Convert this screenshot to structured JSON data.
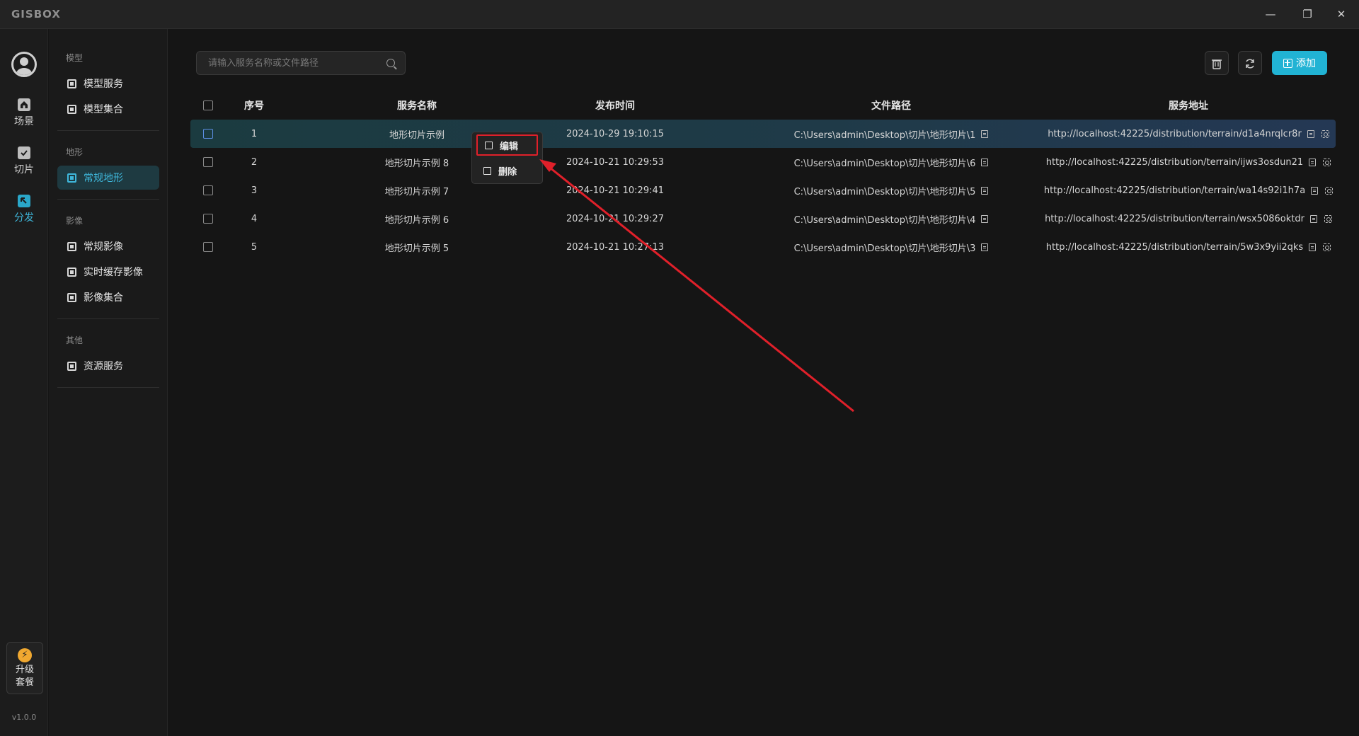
{
  "app": {
    "logo": "GISBOX",
    "window_controls": {
      "minimize": "—",
      "maximize": "❐",
      "close": "✕"
    }
  },
  "rail": {
    "items": [
      {
        "label": "场景",
        "icon": "home-icon",
        "active": false
      },
      {
        "label": "切片",
        "icon": "slice-icon",
        "active": false
      },
      {
        "label": "分发",
        "icon": "distribute-icon",
        "active": true
      }
    ],
    "upgrade": {
      "icon": "⚡",
      "label": "升级套餐"
    },
    "version": "v1.0.0"
  },
  "sidebar": {
    "groups": [
      {
        "title": "模型",
        "items": [
          {
            "label": "模型服务",
            "active": false
          },
          {
            "label": "模型集合",
            "active": false
          }
        ]
      },
      {
        "title": "地形",
        "items": [
          {
            "label": "常规地形",
            "active": true
          }
        ]
      },
      {
        "title": "影像",
        "items": [
          {
            "label": "常规影像",
            "active": false
          },
          {
            "label": "实时缓存影像",
            "active": false
          },
          {
            "label": "影像集合",
            "active": false
          }
        ]
      },
      {
        "title": "其他",
        "items": [
          {
            "label": "资源服务",
            "active": false
          }
        ]
      }
    ]
  },
  "toolbar": {
    "search_placeholder": "请输入服务名称或文件路径",
    "add_label": "添加"
  },
  "table": {
    "headers": {
      "index": "序号",
      "name": "服务名称",
      "time": "发布时间",
      "path": "文件路径",
      "url": "服务地址"
    },
    "rows": [
      {
        "index": "1",
        "name": "地形切片示例",
        "time": "2024-10-29 19:10:15",
        "path": "C:\\Users\\admin\\Desktop\\切片\\地形切片\\1",
        "url": "http://localhost:42225/distribution/terrain/d1a4nrqlcr8r",
        "selected": true
      },
      {
        "index": "2",
        "name": "地形切片示例 8",
        "time": "2024-10-21 10:29:53",
        "path": "C:\\Users\\admin\\Desktop\\切片\\地形切片\\6",
        "url": "http://localhost:42225/distribution/terrain/ijws3osdun21",
        "selected": false
      },
      {
        "index": "3",
        "name": "地形切片示例 7",
        "time": "2024-10-21 10:29:41",
        "path": "C:\\Users\\admin\\Desktop\\切片\\地形切片\\5",
        "url": "http://localhost:42225/distribution/terrain/wa14s92i1h7a",
        "selected": false
      },
      {
        "index": "4",
        "name": "地形切片示例 6",
        "time": "2024-10-21 10:29:27",
        "path": "C:\\Users\\admin\\Desktop\\切片\\地形切片\\4",
        "url": "http://localhost:42225/distribution/terrain/wsx5086oktdr",
        "selected": false
      },
      {
        "index": "5",
        "name": "地形切片示例 5",
        "time": "2024-10-21 10:27:13",
        "path": "C:\\Users\\admin\\Desktop\\切片\\地形切片\\3",
        "url": "http://localhost:42225/distribution/terrain/5w3x9yii2qks",
        "selected": false
      }
    ]
  },
  "context_menu": {
    "items": [
      {
        "label": "编辑",
        "icon": "edit-icon",
        "highlighted": true
      },
      {
        "label": "删除",
        "icon": "trash-icon",
        "highlighted": false
      }
    ]
  },
  "colors": {
    "accent": "#21b3d4",
    "active_text": "#3fb8dc",
    "annotation_red": "#e0202a",
    "background": "#151515"
  }
}
